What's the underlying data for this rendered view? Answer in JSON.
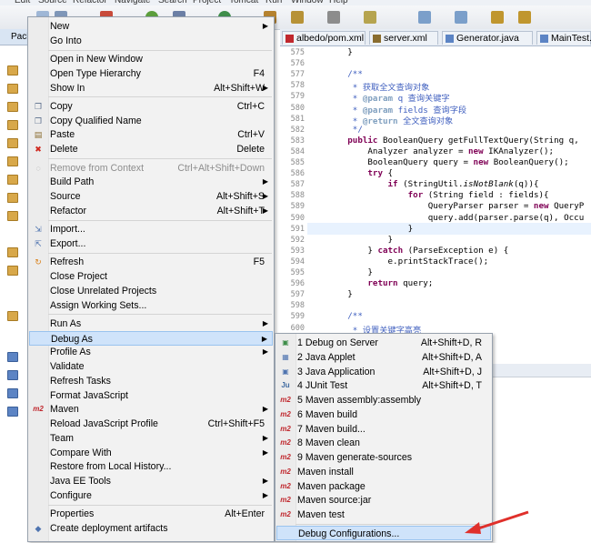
{
  "menubar": {
    "items": [
      "Edit",
      "Source",
      "Refactor",
      "Navigate",
      "Search",
      "Project",
      "Tomcat",
      "Run",
      "Window",
      "Help"
    ]
  },
  "package_explorer": {
    "tab_label": "Package"
  },
  "editor_tabs": [
    {
      "label": "albedo/pom.xml",
      "icon": "maven-pom-icon"
    },
    {
      "label": "server.xml",
      "icon": "xml-file-icon"
    },
    {
      "label": "Generator.java",
      "icon": "java-file-icon"
    },
    {
      "label": "MainTest.java",
      "icon": "java-file-icon"
    }
  ],
  "editor": {
    "lines": [
      {
        "num": "575",
        "text": "        }"
      },
      {
        "num": "576",
        "text": ""
      },
      {
        "num": "577",
        "text": "        /**"
      },
      {
        "num": "578",
        "text": "         * 获取全文查询对象"
      },
      {
        "num": "579",
        "text": "         * @param q 查询关键字"
      },
      {
        "num": "580",
        "text": "         * @param fields 查询字段"
      },
      {
        "num": "581",
        "text": "         * @return 全文查询对象"
      },
      {
        "num": "582",
        "text": "         */"
      },
      {
        "num": "583",
        "text": "        public BooleanQuery getFullTextQuery(String q,"
      },
      {
        "num": "584",
        "text": "            Analyzer analyzer = new IKAnalyzer();"
      },
      {
        "num": "585",
        "text": "            BooleanQuery query = new BooleanQuery();"
      },
      {
        "num": "586",
        "text": "            try {"
      },
      {
        "num": "587",
        "text": "                if (StringUtil.isNotBlank(q)){"
      },
      {
        "num": "588",
        "text": "                    for (String field : fields){"
      },
      {
        "num": "589",
        "text": "                        QueryParser parser = new QueryP"
      },
      {
        "num": "590",
        "text": "                        query.add(parser.parse(q), Occu"
      },
      {
        "num": "591",
        "text": "                    }"
      },
      {
        "num": "592",
        "text": "                }"
      },
      {
        "num": "593",
        "text": "            } catch (ParseException e) {"
      },
      {
        "num": "594",
        "text": "                e.printStackTrace();"
      },
      {
        "num": "595",
        "text": "            }"
      },
      {
        "num": "596",
        "text": "            return query;"
      },
      {
        "num": "597",
        "text": "        }"
      },
      {
        "num": "598",
        "text": ""
      },
      {
        "num": "599",
        "text": "        /**"
      },
      {
        "num": "600",
        "text": "         * 设置关键字高亮"
      }
    ]
  },
  "context_menu": {
    "items": [
      {
        "label": "New",
        "shortcut": "",
        "submenu": true,
        "icon": ""
      },
      {
        "label": "Go Into",
        "shortcut": "",
        "submenu": false,
        "icon": ""
      },
      {
        "sep": true
      },
      {
        "label": "Open in New Window",
        "shortcut": "",
        "submenu": false,
        "icon": ""
      },
      {
        "label": "Open Type Hierarchy",
        "shortcut": "F4",
        "submenu": false,
        "icon": ""
      },
      {
        "label": "Show In",
        "shortcut": "Alt+Shift+W",
        "submenu": true,
        "icon": ""
      },
      {
        "sep": true
      },
      {
        "label": "Copy",
        "shortcut": "Ctrl+C",
        "submenu": false,
        "icon": "copy-icon"
      },
      {
        "label": "Copy Qualified Name",
        "shortcut": "",
        "submenu": false,
        "icon": "copy-icon"
      },
      {
        "label": "Paste",
        "shortcut": "Ctrl+V",
        "submenu": false,
        "icon": "paste-icon"
      },
      {
        "label": "Delete",
        "shortcut": "Delete",
        "submenu": false,
        "icon": "delete-icon"
      },
      {
        "sep": true
      },
      {
        "label": "Remove from Context",
        "shortcut": "Ctrl+Alt+Shift+Down",
        "submenu": false,
        "icon": "remove-icon",
        "disabled": true
      },
      {
        "label": "Build Path",
        "shortcut": "",
        "submenu": true,
        "icon": ""
      },
      {
        "label": "Source",
        "shortcut": "Alt+Shift+S",
        "submenu": true,
        "icon": ""
      },
      {
        "label": "Refactor",
        "shortcut": "Alt+Shift+T",
        "submenu": true,
        "icon": ""
      },
      {
        "sep": true
      },
      {
        "label": "Import...",
        "shortcut": "",
        "submenu": false,
        "icon": "import-icon"
      },
      {
        "label": "Export...",
        "shortcut": "",
        "submenu": false,
        "icon": "export-icon"
      },
      {
        "sep": true
      },
      {
        "label": "Refresh",
        "shortcut": "F5",
        "submenu": false,
        "icon": "refresh-icon"
      },
      {
        "label": "Close Project",
        "shortcut": "",
        "submenu": false,
        "icon": ""
      },
      {
        "label": "Close Unrelated Projects",
        "shortcut": "",
        "submenu": false,
        "icon": ""
      },
      {
        "label": "Assign Working Sets...",
        "shortcut": "",
        "submenu": false,
        "icon": ""
      },
      {
        "sep": true
      },
      {
        "label": "Run As",
        "shortcut": "",
        "submenu": true,
        "icon": ""
      },
      {
        "label": "Debug As",
        "shortcut": "",
        "submenu": true,
        "icon": "",
        "selected": true
      },
      {
        "label": "Profile As",
        "shortcut": "",
        "submenu": true,
        "icon": ""
      },
      {
        "label": "Validate",
        "shortcut": "",
        "submenu": false,
        "icon": ""
      },
      {
        "label": "Refresh Tasks",
        "shortcut": "",
        "submenu": false,
        "icon": ""
      },
      {
        "label": "Format JavaScript",
        "shortcut": "",
        "submenu": false,
        "icon": ""
      },
      {
        "label": "Maven",
        "shortcut": "",
        "submenu": true,
        "icon": "maven-icon"
      },
      {
        "label": "Reload JavaScript Profile",
        "shortcut": "Ctrl+Shift+F5",
        "submenu": false,
        "icon": ""
      },
      {
        "label": "Team",
        "shortcut": "",
        "submenu": true,
        "icon": ""
      },
      {
        "label": "Compare With",
        "shortcut": "",
        "submenu": true,
        "icon": ""
      },
      {
        "label": "Restore from Local History...",
        "shortcut": "",
        "submenu": false,
        "icon": ""
      },
      {
        "label": "Java EE Tools",
        "shortcut": "",
        "submenu": true,
        "icon": ""
      },
      {
        "label": "Configure",
        "shortcut": "",
        "submenu": true,
        "icon": ""
      },
      {
        "sep": true
      },
      {
        "label": "Properties",
        "shortcut": "Alt+Enter",
        "submenu": false,
        "icon": ""
      },
      {
        "label": "Create deployment artifacts",
        "shortcut": "",
        "submenu": false,
        "icon": "deploy-icon"
      }
    ]
  },
  "debug_submenu": {
    "items": [
      {
        "label": "1 Debug on Server",
        "shortcut": "Alt+Shift+D, R",
        "icon": "server-icon"
      },
      {
        "label": "2 Java Applet",
        "shortcut": "Alt+Shift+D, A",
        "icon": "applet-icon"
      },
      {
        "label": "3 Java Application",
        "shortcut": "Alt+Shift+D, J",
        "icon": "java-app-icon"
      },
      {
        "label": "4 JUnit Test",
        "shortcut": "Alt+Shift+D, T",
        "icon": "junit-icon"
      },
      {
        "label": "5 Maven assembly:assembly",
        "shortcut": "",
        "icon": "maven-icon"
      },
      {
        "label": "6 Maven build",
        "shortcut": "",
        "icon": "maven-icon"
      },
      {
        "label": "7 Maven build...",
        "shortcut": "",
        "icon": "maven-icon"
      },
      {
        "label": "8 Maven clean",
        "shortcut": "",
        "icon": "maven-icon"
      },
      {
        "label": "9 Maven generate-sources",
        "shortcut": "",
        "icon": "maven-icon"
      },
      {
        "label": "Maven install",
        "shortcut": "",
        "icon": "maven-icon"
      },
      {
        "label": "Maven package",
        "shortcut": "",
        "icon": "maven-icon"
      },
      {
        "label": "Maven source:jar",
        "shortcut": "",
        "icon": "maven-icon"
      },
      {
        "label": "Maven test",
        "shortcut": "",
        "icon": "maven-icon"
      },
      {
        "sep": true
      },
      {
        "label": "Debug Configurations...",
        "shortcut": "",
        "icon": "",
        "selected": true
      }
    ]
  },
  "colors": {
    "selection": "#cfe3fa",
    "annotation_arrow": "#e0302b",
    "keyword": "#7f0055",
    "javadoc": "#3f5fbf"
  }
}
